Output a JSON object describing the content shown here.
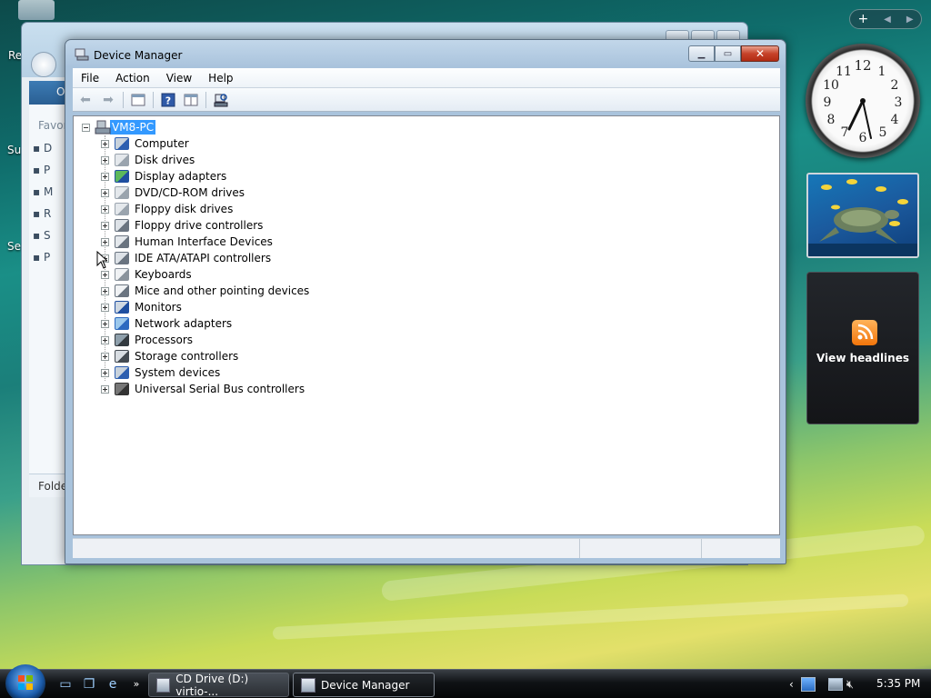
{
  "desktop": {
    "icons": [
      "Re",
      "Sup",
      "Sea"
    ]
  },
  "background_window": {
    "sidebar_header": "O",
    "favorites_label": "Favor",
    "items": [
      "D",
      "P",
      "M",
      "R",
      "S",
      "P"
    ],
    "folders_label": "Folde"
  },
  "device_manager": {
    "title": "Device Manager",
    "menu": [
      "File",
      "Action",
      "View",
      "Help"
    ],
    "toolbar": [
      "back-icon",
      "forward-icon",
      "properties-view-icon",
      "help-icon",
      "details-view-icon",
      "scan-hardware-icon"
    ],
    "tree": {
      "root": "VM8-PC",
      "items": [
        {
          "label": "Computer",
          "icon": "computer-icon"
        },
        {
          "label": "Disk drives",
          "icon": "disk-drive-icon"
        },
        {
          "label": "Display adapters",
          "icon": "display-adapter-icon"
        },
        {
          "label": "DVD/CD-ROM drives",
          "icon": "dvd-drive-icon"
        },
        {
          "label": "Floppy disk drives",
          "icon": "floppy-drive-icon"
        },
        {
          "label": "Floppy drive controllers",
          "icon": "floppy-controller-icon"
        },
        {
          "label": "Human Interface Devices",
          "icon": "hid-icon"
        },
        {
          "label": "IDE ATA/ATAPI controllers",
          "icon": "ide-controller-icon"
        },
        {
          "label": "Keyboards",
          "icon": "keyboard-icon"
        },
        {
          "label": "Mice and other pointing devices",
          "icon": "mouse-icon"
        },
        {
          "label": "Monitors",
          "icon": "monitor-icon"
        },
        {
          "label": "Network adapters",
          "icon": "network-adapter-icon"
        },
        {
          "label": "Processors",
          "icon": "processor-icon"
        },
        {
          "label": "Storage controllers",
          "icon": "storage-controller-icon"
        },
        {
          "label": "System devices",
          "icon": "system-device-icon"
        },
        {
          "label": "Universal Serial Bus controllers",
          "icon": "usb-icon"
        }
      ]
    }
  },
  "gadgets": {
    "news_label": "View headlines"
  },
  "taskbar": {
    "buttons": [
      {
        "label": "CD Drive (D:) virtio-...",
        "active": false
      },
      {
        "label": "Device Manager",
        "active": true
      }
    ],
    "time": "5:35 PM"
  }
}
